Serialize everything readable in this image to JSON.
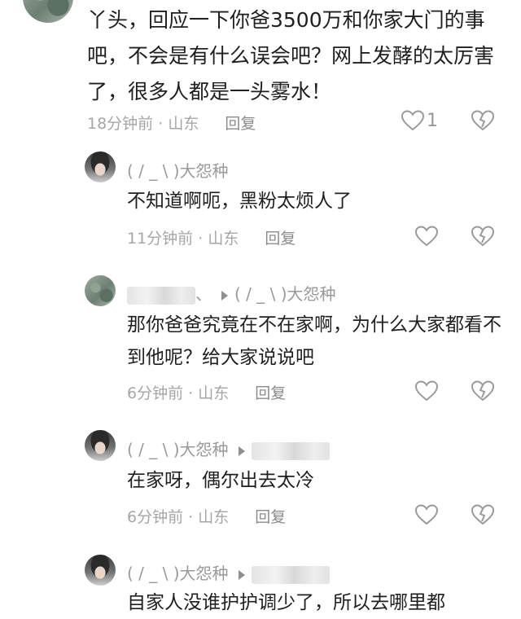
{
  "main_comment": {
    "text": "丫头，回应一下你爸3500万和你家大门的事吧，不会是有什么误会吧？网上发酵的太厉害了，很多人都是一头雾水！",
    "time": "18分钟前",
    "location": "山东",
    "reply_label": "回复",
    "like_count": "1"
  },
  "replies": [
    {
      "author": "( / _ \\ )大怨种",
      "text": "不知道啊呃，黑粉太烦人了",
      "time": "11分钟前",
      "location": "山东",
      "reply_label": "回复"
    },
    {
      "author_prefix": "、",
      "reply_to": "( / _ \\ )大怨种",
      "text": "那你爸爸究竟在不在家啊，为什么大家都看不到他呢？给大家说说吧",
      "time": "6分钟前",
      "location": "山东",
      "reply_label": "回复"
    },
    {
      "author": "( / _ \\ )大怨种",
      "text": "在家呀，偶尔出去太冷",
      "time": "6分钟前",
      "location": "山东",
      "reply_label": "回复"
    },
    {
      "author": "( / _ \\ )大怨种",
      "text": "自家人没谁护护调少了，所以去哪里都"
    }
  ],
  "separator": " · ",
  "icons": {
    "like": "heart-outline-icon",
    "dislike": "broken-heart-icon",
    "reply_arrow": "triangle-right-icon"
  }
}
